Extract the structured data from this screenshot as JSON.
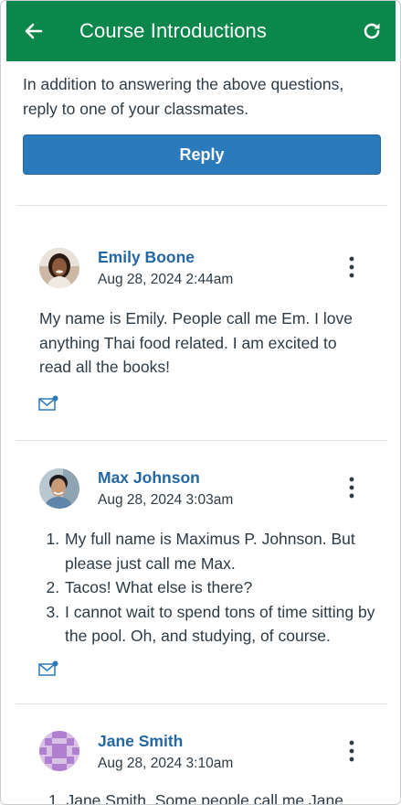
{
  "header": {
    "title": "Course Introductions",
    "back_icon": "arrow-left-icon",
    "refresh_icon": "refresh-icon",
    "color": "#0b874b"
  },
  "intro": {
    "text": "In addition to answering the above questions, reply to one of your classmates.",
    "reply_label": "Reply",
    "reply_color": "#2b7abc"
  },
  "entries": [
    {
      "author": "Emily Boone",
      "timestamp": "Aug 28, 2024 2:44am",
      "body": "My name is Emily. People call me Em. I love anything Thai food related. I am excited to read all the books!"
    },
    {
      "author": "Max Johnson",
      "timestamp": "Aug 28, 2024 3:03am",
      "list": [
        "My full name is Maximus P. Johnson. But please just call me Max.",
        "Tacos! What else is there?",
        "I cannot wait to spend tons of time sitting by the pool. Oh, and studying, of course."
      ]
    },
    {
      "author": "Jane Smith",
      "timestamp": "Aug 28, 2024 3:10am",
      "partial": "1. Jane Smith. Some people call me Jane."
    }
  ],
  "colors": {
    "author_link": "#2467a3",
    "unread_dot": "#2b7abc"
  }
}
